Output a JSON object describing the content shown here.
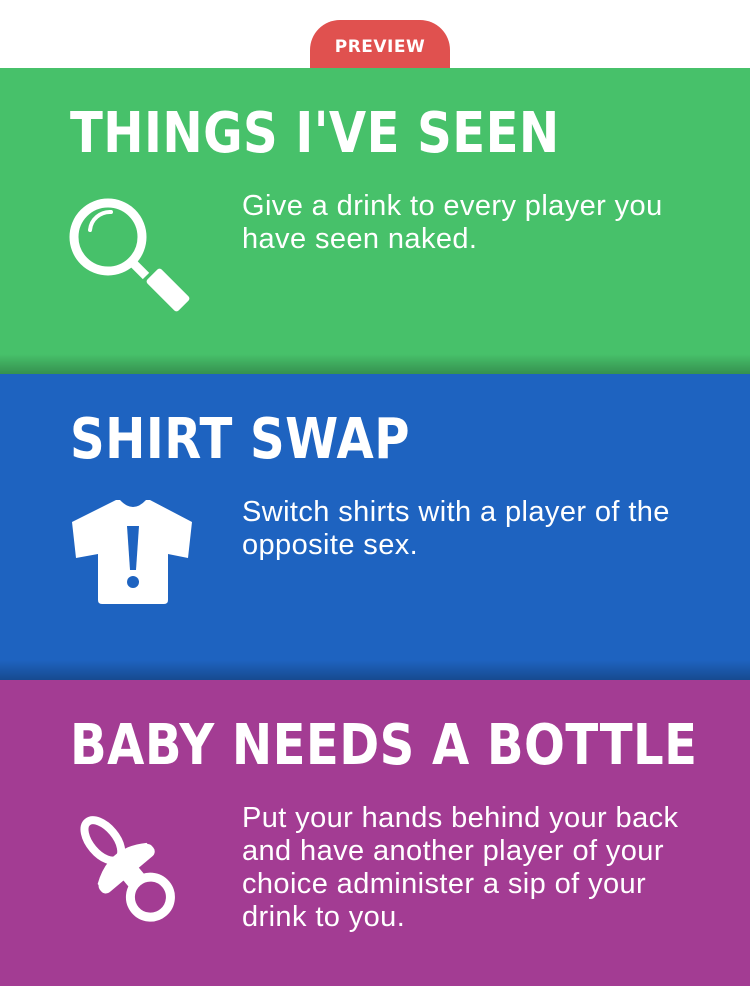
{
  "preview_label": "PREVIEW",
  "cards": [
    {
      "title": "THINGS I'VE SEEN",
      "description": "Give a drink to every player you have seen naked.",
      "icon": "magnifying-glass-icon",
      "color": "#47c16a"
    },
    {
      "title": "SHIRT SWAP",
      "description": "Switch shirts with a player of the opposite sex.",
      "icon": "shirt-exclamation-icon",
      "color": "#1e63c0"
    },
    {
      "title": "BABY NEEDS A BOTTLE",
      "description": "Put your hands behind your back and have another player of your choice administer a sip of your drink to you.",
      "icon": "pacifier-icon",
      "color": "#a33c93"
    }
  ],
  "colors": {
    "preview_tab": "#e0514f"
  }
}
